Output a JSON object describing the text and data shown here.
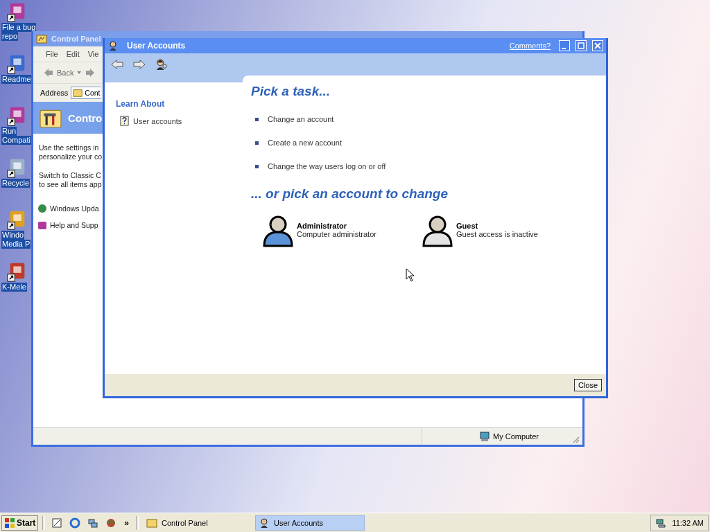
{
  "desktop": {
    "icons": [
      {
        "lines": [
          "File a bug",
          "repo"
        ]
      },
      {
        "lines": [
          "Readme"
        ]
      },
      {
        "lines": [
          "Run",
          "Compati"
        ]
      },
      {
        "lines": [
          "Recycle"
        ]
      },
      {
        "lines": [
          "Windo",
          "Media P"
        ]
      },
      {
        "lines": [
          "K-Mele"
        ]
      }
    ]
  },
  "control_panel": {
    "title": "Control Panel",
    "menu": [
      "File",
      "Edit",
      "Vie"
    ],
    "back": "Back",
    "address_label": "Address",
    "address_value": "Cont",
    "header": "Contro",
    "paragraphs": [
      [
        "Use the settings in",
        "personalize your co"
      ],
      [
        "Switch to Classic C",
        "to see all items app"
      ]
    ],
    "links": [
      "Windows Upda",
      "Help and Supp"
    ],
    "status": "My Computer"
  },
  "user_accounts": {
    "title": "User Accounts",
    "comments": "Comments?",
    "learn_about": "Learn About",
    "learn_links": [
      "User accounts"
    ],
    "task_heading": "Pick a task...",
    "tasks": [
      "Change an account",
      "Create a new account",
      "Change the way users log on or off"
    ],
    "account_heading": "... or pick an account to change",
    "accounts": [
      {
        "name": "Administrator",
        "description": "Computer administrator",
        "color": "#5b93d8"
      },
      {
        "name": "Guest",
        "description": "Guest access is inactive",
        "color": "#e4e4e4"
      }
    ],
    "close": "Close"
  },
  "taskbar": {
    "start": "Start",
    "more": "»",
    "tasks": [
      {
        "label": "Control Panel",
        "selected": false
      },
      {
        "label": "User Accounts",
        "selected": true
      }
    ],
    "clock": "11:32 AM"
  }
}
